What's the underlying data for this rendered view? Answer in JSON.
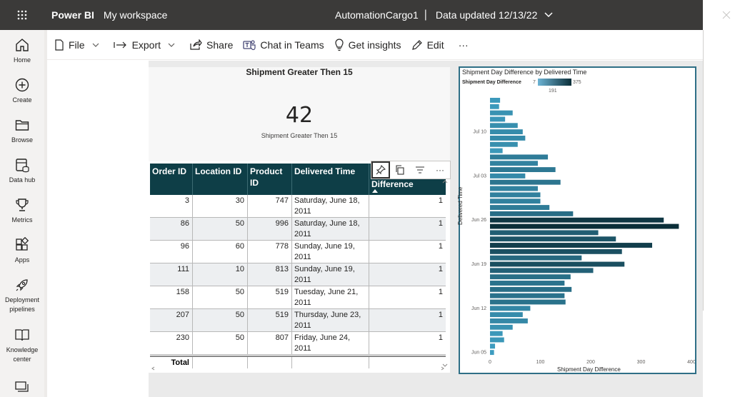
{
  "topbar": {
    "app_name": "Power BI",
    "workspace": "My workspace",
    "report_name": "AutomationCargo1",
    "separator": "|",
    "data_updated": "Data updated 12/13/22"
  },
  "leftnav": {
    "items": [
      {
        "label": "Home",
        "icon": "home-icon"
      },
      {
        "label": "Create",
        "icon": "plus-circle-icon"
      },
      {
        "label": "Browse",
        "icon": "folder-icon"
      },
      {
        "label": "Data hub",
        "icon": "database-icon"
      },
      {
        "label": "Metrics",
        "icon": "trophy-icon"
      },
      {
        "label": "Apps",
        "icon": "apps-icon"
      },
      {
        "label": "Deployment pipelines",
        "icon": "rocket-icon"
      },
      {
        "label": "Knowledge center",
        "icon": "book-icon"
      }
    ]
  },
  "toolbar": {
    "file": "File",
    "export": "Export",
    "share": "Share",
    "chat": "Chat in Teams",
    "insights": "Get insights",
    "edit": "Edit",
    "more": "···"
  },
  "card": {
    "title": "Shipment Greater Then 15",
    "value": "42",
    "label": "Shipment Greater Then 15"
  },
  "table": {
    "columns": [
      "Order ID",
      "Location ID",
      "Product ID",
      "Delivered Time",
      "Difference"
    ],
    "rows": [
      {
        "order_id": "3",
        "location_id": "30",
        "product_id": "747",
        "delivered": "Saturday, June 18, 2011",
        "diff": "1"
      },
      {
        "order_id": "86",
        "location_id": "50",
        "product_id": "996",
        "delivered": "Saturday, June 18, 2011",
        "diff": "1"
      },
      {
        "order_id": "96",
        "location_id": "60",
        "product_id": "778",
        "delivered": "Sunday, June 19, 2011",
        "diff": "1"
      },
      {
        "order_id": "111",
        "location_id": "10",
        "product_id": "813",
        "delivered": "Sunday, June 19, 2011",
        "diff": "1"
      },
      {
        "order_id": "158",
        "location_id": "50",
        "product_id": "519",
        "delivered": "Tuesday, June 21, 2011",
        "diff": "1"
      },
      {
        "order_id": "207",
        "location_id": "50",
        "product_id": "519",
        "delivered": "Thursday, June 23, 2011",
        "diff": "1"
      },
      {
        "order_id": "230",
        "location_id": "50",
        "product_id": "807",
        "delivered": "Friday, June 24, 2011",
        "diff": "1"
      }
    ],
    "total_label": "Total"
  },
  "visual_header": {
    "more": "···"
  },
  "chart_data": {
    "type": "bar",
    "orientation": "horizontal",
    "title": "Shipment Day Difference by Delivered Time",
    "xlabel": "Shipment Day Difference",
    "ylabel": "Delivered Time",
    "legend_title": "Shipment Day Difference",
    "legend_min": "7",
    "legend_mid": "191",
    "legend_max": "375",
    "xlim": [
      0,
      400
    ],
    "xticks": [
      "0",
      "100",
      "200",
      "300",
      "400"
    ],
    "ytick_labels": [
      "Jul 10",
      "Jul 03",
      "Jun 26",
      "Jun 19",
      "Jun 12",
      "Jun 05"
    ],
    "values": [
      20,
      18,
      45,
      30,
      55,
      65,
      70,
      55,
      25,
      115,
      95,
      130,
      70,
      140,
      95,
      100,
      100,
      118,
      165,
      345,
      375,
      215,
      250,
      322,
      262,
      182,
      267,
      205,
      160,
      148,
      162,
      148,
      150,
      80,
      65,
      75,
      45,
      25,
      28,
      10,
      8
    ]
  }
}
